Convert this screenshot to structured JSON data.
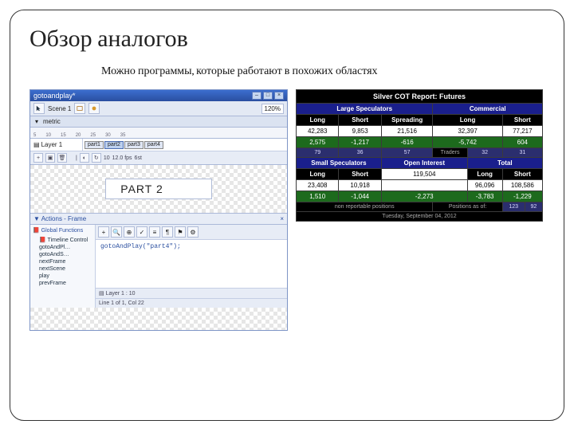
{
  "slide": {
    "title": "Обзор аналогов",
    "subtitle": "Можно программы, которые работают в похожих областях"
  },
  "editor": {
    "window_title": "gotoandplay*",
    "zoom": "120%",
    "scene_tab": "Scene 1",
    "metric_label": "metric",
    "ruler_marks": [
      "5",
      "10",
      "15",
      "20",
      "25",
      "30",
      "35"
    ],
    "layer_name": "Layer 1",
    "parts": [
      "part1",
      "part2",
      "part3",
      "part4"
    ],
    "active_part_index": 1,
    "status_frame": "10",
    "status_fps": "12.0 fps",
    "status_time": "6st",
    "stage_label": "PART 2",
    "actions_title": "Actions - Frame",
    "actions_root": "Global Functions",
    "actions_group": "Timeline Control",
    "actions_nodes": [
      "gotoAndPl…",
      "gotoAndS…",
      "nextFrame",
      "nextScene",
      "play",
      "prevFrame"
    ],
    "code_line": "gotoAndPlay(\"part4\");",
    "code_layer": "Layer 1 : 10",
    "code_pos": "Line 1 of 1, Col 22"
  },
  "cot": {
    "title": "Silver COT Report: Futures",
    "sections": {
      "large": "Large Speculators",
      "comm": "Commercial",
      "small": "Small Speculators",
      "oi": "Open Interest",
      "total": "Total"
    },
    "cols": {
      "long": "Long",
      "short": "Short",
      "spread": "Spreading"
    },
    "traders_label": "Traders",
    "large": {
      "long": "42,283",
      "short": "9,853",
      "spread": "21,516",
      "long_chg": "2,575",
      "short_chg": "-1,217",
      "spread_chg": "-616",
      "t1": "79",
      "t2": "36",
      "t3": "57"
    },
    "comm": {
      "long": "32,397",
      "short": "77,217",
      "long_chg": "-5,742",
      "short_chg": "604",
      "t1": "32",
      "t2": "31"
    },
    "small": {
      "long": "23,408",
      "short": "10,918",
      "long_chg": "1,510",
      "short_chg": "-1,044"
    },
    "oi": {
      "value": "119,504",
      "chg": "-2,273"
    },
    "total": {
      "long": "96,096",
      "short": "108,586",
      "long_chg": "-3,783",
      "short_chg": "-1,229"
    },
    "nonreport": "non reportable positions",
    "nr1": "123",
    "nr2": "92",
    "asof_label": "Positions as of:",
    "asof_date": "Tuesday, September 04, 2012"
  }
}
